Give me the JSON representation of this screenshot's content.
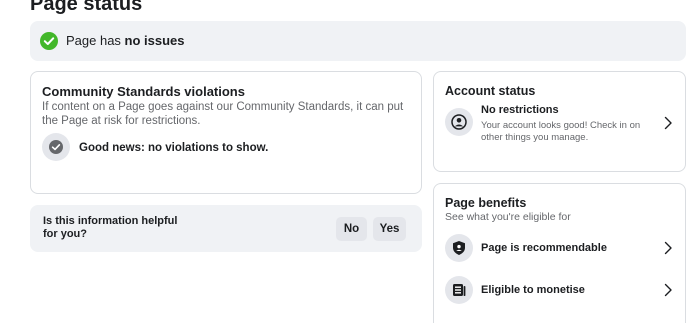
{
  "header": {
    "title": "Page status"
  },
  "status": {
    "prefix": "Page has ",
    "emphasis": "no issues",
    "color": "#42b72a"
  },
  "violations": {
    "title": "Community Standards violations",
    "description": "If content on a Page goes against our Community Standards, it can put the Page at risk for restrictions.",
    "good_news": "Good news: no violations to show."
  },
  "feedback": {
    "question": "Is this information helpful for you?",
    "no_label": "No",
    "yes_label": "Yes"
  },
  "account": {
    "title": "Account status",
    "item_title": "No restrictions",
    "item_subtitle": "Your account looks good! Check in on other things you manage."
  },
  "benefits": {
    "title": "Page benefits",
    "subtitle": "See what you're eligible for",
    "items": [
      {
        "label": "Page is recommendable",
        "icon": "shield-check-icon"
      },
      {
        "label": "Eligible to monetise",
        "icon": "money-icon"
      }
    ]
  }
}
